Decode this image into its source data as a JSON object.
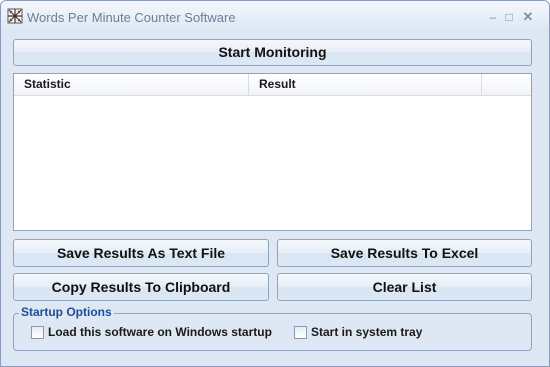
{
  "window": {
    "title": "Words Per Minute Counter Software",
    "icons": {
      "app": "wpm-app-icon",
      "minimize": "minimize-icon",
      "maximize": "maximize-icon",
      "close": "close-icon"
    }
  },
  "main": {
    "start_button": "Start Monitoring",
    "table": {
      "columns": [
        "Statistic",
        "Result"
      ],
      "rows": []
    },
    "buttons": {
      "save_text": "Save Results As Text File",
      "save_excel": "Save Results To Excel",
      "copy_clipboard": "Copy Results To Clipboard",
      "clear_list": "Clear List"
    }
  },
  "startup_options": {
    "legend": "Startup Options",
    "load_on_startup": {
      "label": "Load this software on Windows startup",
      "checked": false
    },
    "start_in_tray": {
      "label": "Start in system tray",
      "checked": false
    }
  },
  "colors": {
    "window_bg": "#dde8f4",
    "border": "#8fa3bd",
    "legend_text": "#1f4e96",
    "title_text": "#6d7f96"
  }
}
